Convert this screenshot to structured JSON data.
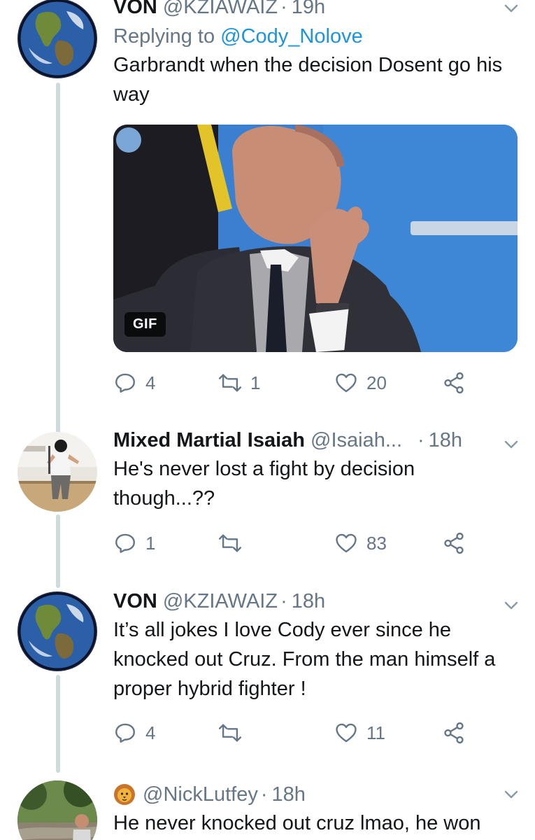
{
  "tweets": [
    {
      "name": "VON",
      "handle": "@KZIAWAIZ",
      "time": "19h",
      "reply_prefix": "Replying to",
      "reply_mention": "@Cody_Nolove",
      "text": "Garbrandt when the decision Dosent go his way",
      "media_badge": "GIF",
      "replies": "4",
      "retweets": "1",
      "likes": "20"
    },
    {
      "name": "Mixed Martial Isaiah",
      "handle": "@Isaiah...",
      "time": "18h",
      "text": "He's never lost a fight by decision though...??",
      "replies": "1",
      "retweets": "",
      "likes": "83"
    },
    {
      "name": "VON",
      "handle": "@KZIAWAIZ",
      "time": "18h",
      "text": "It’s all jokes I love Cody ever since he knocked out Cruz. From the man himself a proper hybrid fighter !",
      "replies": "4",
      "retweets": "",
      "likes": "11"
    },
    {
      "name_emoji": "lion-emoji",
      "handle": "@NickLutfey",
      "time": "18h",
      "text": "He never knocked out cruz lmao, he won"
    }
  ],
  "colors": {
    "text": "#14171a",
    "muted": "#657786",
    "link": "#1b95e0",
    "thread_line": "#cfd9de"
  },
  "icons": [
    "reply-icon",
    "retweet-icon",
    "like-icon",
    "share-icon",
    "chevron-down-icon",
    "earth-avatar",
    "lion-emoji"
  ]
}
